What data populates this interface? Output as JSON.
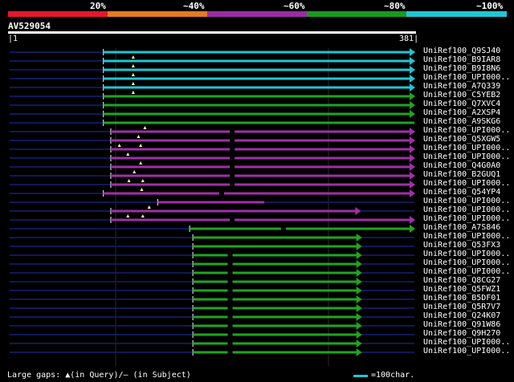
{
  "header": {
    "percent_labels": [
      "20%",
      "~40%",
      "~60%",
      "~80%",
      "~100%"
    ],
    "bands": [
      {
        "color": "#e5182c"
      },
      {
        "color": "#e57a22"
      },
      {
        "color": "#9b2ca3"
      },
      {
        "color": "#189a1e"
      },
      {
        "color": "#1fc6d3"
      }
    ]
  },
  "query": {
    "name": "AV529054",
    "start": "1",
    "end": "381",
    "length": 381
  },
  "colors": {
    "cyan": "#1fc6d3",
    "green": "#1fa51f",
    "purple": "#a02fa8",
    "navy": "#101858",
    "triangle": "#ffff99"
  },
  "hits": [
    {
      "label": "UniRef100_Q9SJ40",
      "color": "cyan",
      "start": 89,
      "end": 381,
      "arrow": true
    },
    {
      "label": "UniRef100_B9IAR8",
      "color": "cyan",
      "start": 89,
      "end": 381,
      "arrow": true,
      "gap": [
        117
      ]
    },
    {
      "label": "UniRef100_B9I8N6",
      "color": "cyan",
      "start": 89,
      "end": 381,
      "arrow": true,
      "gap": [
        117
      ]
    },
    {
      "label": "UniRef100_UPI000..",
      "color": "cyan",
      "start": 89,
      "end": 381,
      "arrow": true,
      "gap": [
        117
      ]
    },
    {
      "label": "UniRef100_A7Q339",
      "color": "cyan",
      "start": 89,
      "end": 381,
      "arrow": true,
      "gap": [
        117
      ]
    },
    {
      "label": "UniRef100_C5YEB2",
      "color": "green",
      "start": 89,
      "end": 381,
      "arrow": true,
      "gap": [
        117
      ]
    },
    {
      "label": "UniRef100_Q7XVC4",
      "color": "green",
      "start": 89,
      "end": 381,
      "arrow": true
    },
    {
      "label": "UniRef100_A2XSP4",
      "color": "green",
      "start": 89,
      "end": 381,
      "arrow": true
    },
    {
      "label": "UniRef100_A9SKG6",
      "color": "green",
      "start": 89,
      "end": 381,
      "arrow": false
    },
    {
      "label": "UniRef100_UPI000..",
      "color": "purple",
      "start": 96,
      "end": 381,
      "arrow": true,
      "gap": [
        128
      ],
      "subj": [
        210
      ]
    },
    {
      "label": "UniRef100_Q5XGW5",
      "color": "purple",
      "start": 96,
      "end": 381,
      "arrow": true,
      "gap": [
        122
      ],
      "subj": [
        210
      ]
    },
    {
      "label": "UniRef100_UPI000..",
      "color": "purple",
      "start": 96,
      "end": 381,
      "arrow": true,
      "gap": [
        104,
        124
      ],
      "subj": [
        210
      ]
    },
    {
      "label": "UniRef100_UPI000..",
      "color": "purple",
      "start": 96,
      "end": 381,
      "arrow": true,
      "gap": [
        112
      ],
      "subj": [
        210
      ]
    },
    {
      "label": "UniRef100_Q4G0A0",
      "color": "purple",
      "start": 96,
      "end": 381,
      "arrow": true,
      "gap": [
        124
      ],
      "subj": [
        210
      ]
    },
    {
      "label": "UniRef100_B2GUQ1",
      "color": "purple",
      "start": 96,
      "end": 381,
      "arrow": true,
      "gap": [
        118
      ],
      "subj": [
        210
      ]
    },
    {
      "label": "UniRef100_UPI000..",
      "color": "purple",
      "start": 96,
      "end": 381,
      "arrow": true,
      "gap": [
        113,
        126
      ],
      "subj": [
        210
      ]
    },
    {
      "label": "UniRef100_Q54YP4",
      "color": "purple",
      "start": 89,
      "end": 381,
      "arrow": true,
      "gap": [
        125
      ],
      "subj": [
        200
      ]
    },
    {
      "label": "UniRef100_UPI000..",
      "color": "purple",
      "start": 140,
      "end": 240,
      "arrow": false
    },
    {
      "label": "UniRef100_UPI000..",
      "color": "purple",
      "start": 96,
      "end": 330,
      "arrow": true,
      "gap": [
        132
      ]
    },
    {
      "label": "UniRef100_UPI000..",
      "color": "purple",
      "start": 96,
      "end": 381,
      "arrow": true,
      "gap": [
        112,
        126
      ],
      "subj": [
        210
      ]
    },
    {
      "label": "UniRef100_A7S846",
      "color": "green",
      "start": 170,
      "end": 381,
      "arrow": true,
      "subj": [
        258
      ]
    },
    {
      "label": "UniRef100_UPI000..",
      "color": "green",
      "start": 173,
      "end": 331,
      "arrow": true
    },
    {
      "label": "UniRef100_Q53FX3",
      "color": "green",
      "start": 173,
      "end": 331,
      "arrow": true
    },
    {
      "label": "UniRef100_UPI000..",
      "color": "green",
      "start": 173,
      "end": 331,
      "arrow": true,
      "subj": [
        208
      ]
    },
    {
      "label": "UniRef100_UPI000..",
      "color": "green",
      "start": 173,
      "end": 331,
      "arrow": true,
      "subj": [
        208
      ]
    },
    {
      "label": "UniRef100_UPI000..",
      "color": "green",
      "start": 173,
      "end": 331,
      "arrow": true,
      "subj": [
        208
      ]
    },
    {
      "label": "UniRef100_Q8CG27",
      "color": "green",
      "start": 173,
      "end": 331,
      "arrow": true,
      "subj": [
        208
      ]
    },
    {
      "label": "UniRef100_Q5FWZ1",
      "color": "green",
      "start": 173,
      "end": 331,
      "arrow": true,
      "subj": [
        208
      ]
    },
    {
      "label": "UniRef100_B5DF01",
      "color": "green",
      "start": 173,
      "end": 331,
      "arrow": true,
      "subj": [
        208
      ]
    },
    {
      "label": "UniRef100_Q5R7V7",
      "color": "green",
      "start": 173,
      "end": 331,
      "arrow": true,
      "subj": [
        208
      ]
    },
    {
      "label": "UniRef100_Q24K07",
      "color": "green",
      "start": 173,
      "end": 331,
      "arrow": true,
      "subj": [
        208
      ]
    },
    {
      "label": "UniRef100_Q91W86",
      "color": "green",
      "start": 173,
      "end": 331,
      "arrow": true,
      "subj": [
        208
      ]
    },
    {
      "label": "UniRef100_Q9H270",
      "color": "green",
      "start": 173,
      "end": 331,
      "arrow": true,
      "subj": [
        208
      ]
    },
    {
      "label": "UniRef100_UPI000..",
      "color": "green",
      "start": 173,
      "end": 331,
      "arrow": true,
      "subj": [
        208
      ]
    },
    {
      "label": "UniRef100_UPI000..",
      "color": "green",
      "start": 173,
      "end": 331,
      "arrow": true,
      "subj": [
        208
      ]
    }
  ],
  "legend": {
    "large_gaps": "Large gaps: ▲(in Query)/– (in Subject)",
    "scale": "=100char."
  }
}
